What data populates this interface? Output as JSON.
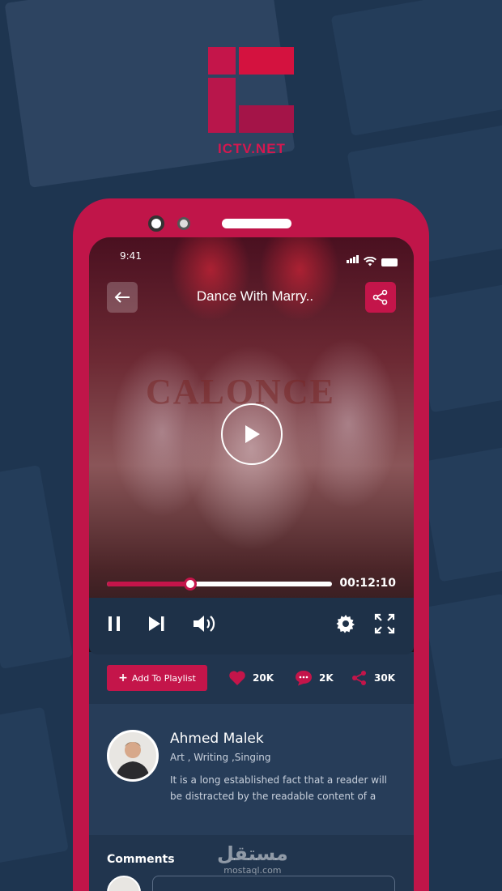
{
  "brand": {
    "name": "ICTV.NET",
    "accent": "#c4154a",
    "background": "#1e3550"
  },
  "status_bar": {
    "time": "9:41"
  },
  "player": {
    "title": "Dance With Marry..",
    "stage_banner": "CALONCE",
    "progress": 0.37,
    "time": "00:12:10",
    "icons": {
      "back": "arrow-left-icon",
      "share": "share-icon",
      "play": "play-icon",
      "pause": "pause-icon",
      "next": "skip-next-icon",
      "volume": "volume-icon",
      "settings": "gear-icon",
      "fullscreen": "fullscreen-icon"
    }
  },
  "actions": {
    "add_playlist": "Add To Playlist",
    "likes": "20K",
    "comments": "2K",
    "shares": "30K"
  },
  "author": {
    "name": "Ahmed Malek",
    "tags": "Art , Writing ,Singing",
    "bio": "It is a long established fact that a reader will be distracted by the readable content of a"
  },
  "comments": {
    "title": "Comments",
    "placeholder": ""
  },
  "watermark": {
    "arabic": "مستقل",
    "latin": "mostaql.com"
  }
}
